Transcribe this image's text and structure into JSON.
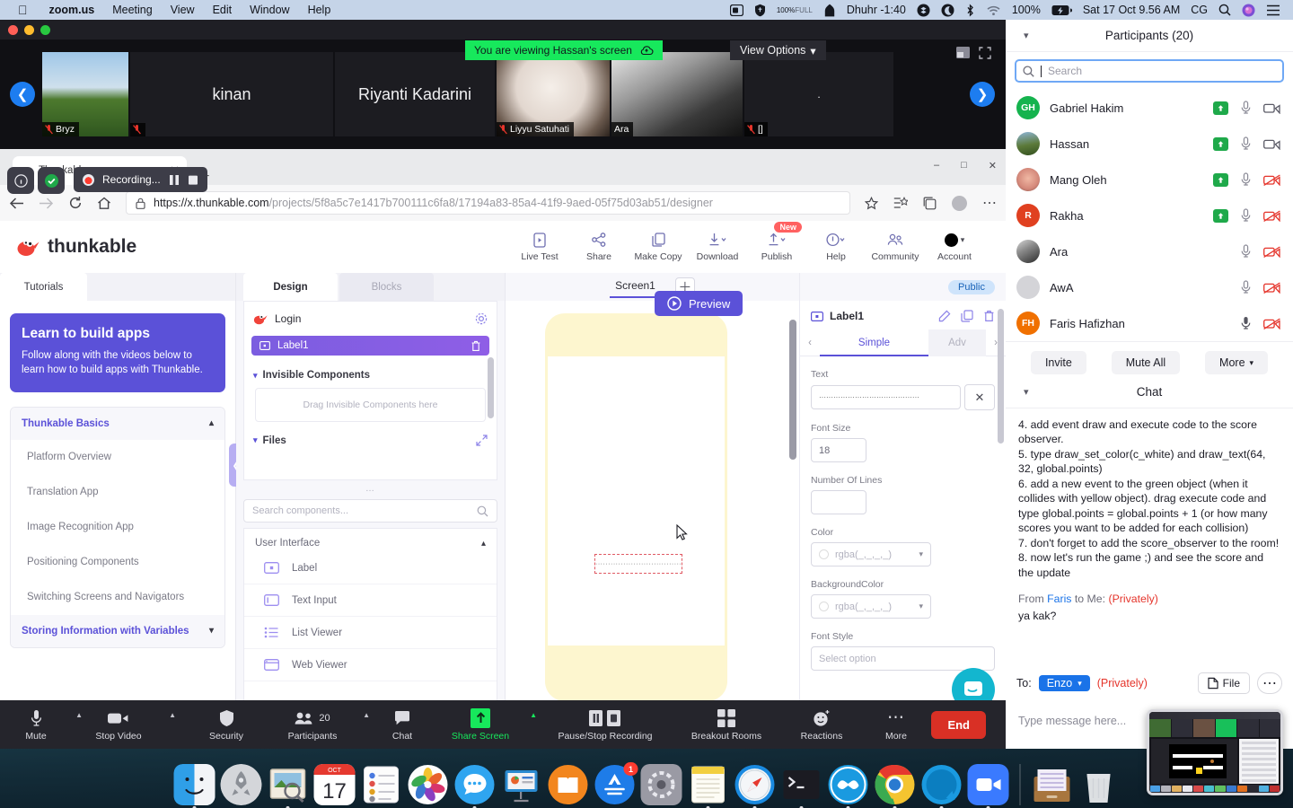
{
  "menubar": {
    "apple_icon": "apple-icon",
    "items": [
      "zoom.us",
      "Meeting",
      "View",
      "Edit",
      "Window",
      "Help"
    ],
    "right": {
      "screen_record_icon": "screen-record-icon",
      "shield_icon": "shield-icon",
      "volume_pct": "100%",
      "volume_sub": "FULL",
      "prayer_icon": "mosque-icon",
      "prayer_label": "Dhuhr -1:40",
      "dropbox_icon": "dropbox-icon",
      "moon_icon": "moon-icon",
      "bluetooth_icon": "bluetooth-icon",
      "wifi_icon": "wifi-icon",
      "battery_pct": "100%",
      "battery_icon": "battery-charging-icon",
      "datetime": "Sat 17 Oct  9.56 AM",
      "user": "CG",
      "search_icon": "search-icon",
      "siri_icon": "siri-icon",
      "controlcenter_icon": "control-center-icon"
    }
  },
  "zoom": {
    "share_banner": "You are viewing Hassan's screen",
    "share_banner_icon": "share-cloud-icon",
    "view_options": "View Options",
    "filmstrip": {
      "prev_icon": "chevron-left-icon",
      "next_icon": "chevron-right-icon",
      "view_icon": "gallery-view-icon",
      "fullscreen_icon": "fullscreen-icon",
      "tiles": [
        {
          "name": "Bryz",
          "display": "",
          "muted": true,
          "kind": "photo-sky"
        },
        {
          "name": "",
          "display": "kinan",
          "muted": true,
          "kind": "name"
        },
        {
          "name": "",
          "display": "Riyanti Kadarini",
          "muted": false,
          "kind": "name"
        },
        {
          "name": "Liyyu Satuhati",
          "display": "",
          "muted": true,
          "kind": "photo-cat"
        },
        {
          "name": "Ara",
          "display": "",
          "muted": false,
          "kind": "photo-bw"
        },
        {
          "name": "[]",
          "display": ".",
          "muted": true,
          "kind": "name"
        }
      ]
    },
    "toolbar": [
      {
        "label": "Mute",
        "icon": "microphone-icon",
        "caret": true
      },
      {
        "label": "Stop Video",
        "icon": "video-camera-icon",
        "caret": true
      },
      {
        "label": "Security",
        "icon": "shield-icon",
        "caret": false
      },
      {
        "label": "Participants",
        "icon": "participants-icon",
        "count": "20",
        "caret": true
      },
      {
        "label": "Chat",
        "icon": "chat-bubble-icon",
        "caret": false
      },
      {
        "label": "Share Screen",
        "icon": "share-screen-icon",
        "caret": true,
        "active": true
      },
      {
        "label": "Pause/Stop Recording",
        "icon": "pause-stop-recording-icon",
        "caret": false
      },
      {
        "label": "Breakout Rooms",
        "icon": "breakout-rooms-icon",
        "caret": false
      },
      {
        "label": "Reactions",
        "icon": "reactions-icon",
        "caret": false
      },
      {
        "label": "More",
        "icon": "more-dots-icon",
        "caret": false
      }
    ],
    "end_label": "End"
  },
  "recording_overlay": {
    "label": "Recording...",
    "record_icon": "record-dot-icon",
    "pause_icon": "pause-icon",
    "stop_icon": "stop-icon",
    "info_icon": "info-icon",
    "shield_icon": "shield-check-icon"
  },
  "browser": {
    "tab_title": "Thunkable",
    "tab_favicon": "thunkable-favicon",
    "close_icon": "close-icon",
    "newtab_icon": "plus-icon",
    "back_icon": "back-arrow-icon",
    "forward_icon": "forward-arrow-icon",
    "reload_icon": "reload-icon",
    "home_icon": "home-icon",
    "lock_icon": "lock-icon",
    "url_prefix": "https://",
    "url_host": "x.thunkable.com",
    "url_path": "/projects/5f8a5c7e1417b700111c6fa8/17194a83-85a4-41f9-9aed-05f75d03ab51/designer",
    "favorite_icon": "star-icon",
    "collections_icon": "collections-icon",
    "tabs_icon": "tab-copy-icon",
    "profile_icon": "profile-icon",
    "settings_icon": "more-dots-icon",
    "win_min": "minimize-icon",
    "win_max": "maximize-icon",
    "win_close": "close-icon"
  },
  "thunkable": {
    "brand": "thunkable",
    "header_actions": [
      {
        "label": "Live Test",
        "icon": "live-test-icon"
      },
      {
        "label": "Share",
        "icon": "share-node-icon"
      },
      {
        "label": "Make Copy",
        "icon": "copy-icon"
      },
      {
        "label": "Download",
        "icon": "download-icon"
      },
      {
        "label": "Publish",
        "icon": "publish-icon",
        "badge": "New"
      },
      {
        "label": "Help",
        "icon": "help-icon"
      },
      {
        "label": "Community",
        "icon": "community-icon"
      },
      {
        "label": "Account",
        "icon": "account-icon"
      }
    ],
    "tutorials": {
      "tab": "Tutorials",
      "banner_title": "Learn to build apps",
      "banner_text": "Follow along with the videos below to learn how to build apps with Thunkable.",
      "section_open": "Thunkable Basics",
      "items": [
        "Platform Overview",
        "Translation App",
        "Image Recognition App",
        "Positioning Components",
        "Switching Screens and Navigators"
      ],
      "section_closed": "Storing Information with Variables",
      "collapse_icon": "chevron-left-icon"
    },
    "designer": {
      "tab_design": "Design",
      "tab_blocks": "Blocks",
      "tree_root": "Login",
      "tree_root_icon": "thunkable-bird-icon",
      "gear_icon": "gear-icon",
      "selected_component": "Label1",
      "selected_icon": "label-icon",
      "delete_icon": "trash-icon",
      "invisible_section": "Invisible Components",
      "dropzone_text": "Drag Invisible Components here",
      "files_section": "Files",
      "expand_icon": "expand-icon",
      "search_placeholder": "Search components...",
      "search_icon": "search-icon",
      "palette_section": "User Interface",
      "palette_items": [
        {
          "label": "Label",
          "icon": "label-icon"
        },
        {
          "label": "Text Input",
          "icon": "text-input-icon"
        },
        {
          "label": "List Viewer",
          "icon": "list-viewer-icon"
        },
        {
          "label": "Web Viewer",
          "icon": "web-viewer-icon"
        }
      ]
    },
    "canvas": {
      "screen_tab": "Screen1",
      "add_screen_icon": "plus-icon",
      "preview_label": "Preview",
      "preview_icon": "play-circle-icon",
      "cursor_icon": "mouse-cursor-icon"
    },
    "properties": {
      "public_badge": "Public",
      "title": "Label1",
      "title_icon": "label-icon",
      "edit_icon": "pencil-icon",
      "duplicate_icon": "duplicate-icon",
      "delete_icon": "trash-icon",
      "tab_simple": "Simple",
      "tab_advanced": "Adv",
      "prev_icon": "chevron-left-icon",
      "next_icon": "chevron-right-icon",
      "fields": [
        {
          "label": "Text",
          "value": "··········································",
          "clear_icon": "close-icon"
        },
        {
          "label": "Font Size",
          "value": "18"
        },
        {
          "label": "Number Of Lines",
          "value": ""
        },
        {
          "label": "Color",
          "value": "rgba(_,_,_,_)"
        },
        {
          "label": "BackgroundColor",
          "value": "rgba(_,_,_,_)"
        },
        {
          "label": "Font Style",
          "value": "Select option"
        }
      ],
      "intercom_icon": "intercom-chat-icon"
    }
  },
  "participants": {
    "title": "Participants (20)",
    "collapse_icon": "chevron-down-icon",
    "search_placeholder": "Search",
    "search_icon": "search-icon",
    "list": [
      {
        "name": "Gabriel Hakim",
        "initials": "GH",
        "color": "#15b34e",
        "raise_hand": true,
        "mic": "mic-on-icon",
        "video": "video-on-icon"
      },
      {
        "name": "Hassan",
        "initials": "",
        "color": "#5c7a3a",
        "raise_hand": true,
        "mic": "mic-on-icon",
        "video": "video-on-icon"
      },
      {
        "name": "Mang Oleh",
        "initials": "",
        "color": "#d4887a",
        "raise_hand": true,
        "mic": "mic-on-icon",
        "video": "video-off-icon"
      },
      {
        "name": "Rakha",
        "initials": "R",
        "color": "#e04020",
        "raise_hand": true,
        "mic": "mic-on-icon",
        "video": "video-off-icon"
      },
      {
        "name": "Ara",
        "initials": "",
        "color": "#4a4a4a",
        "raise_hand": false,
        "mic": "mic-on-icon",
        "video": "video-off-icon"
      },
      {
        "name": "AwA",
        "initials": "",
        "color": "#d4d4d8",
        "raise_hand": false,
        "mic": "mic-on-icon",
        "video": "video-off-icon"
      },
      {
        "name": "Faris Hafizhan",
        "initials": "FH",
        "color": "#f07000",
        "raise_hand": false,
        "mic": "mic-on-icon",
        "video": "video-off-icon"
      }
    ],
    "buttons": {
      "invite": "Invite",
      "mute_all": "Mute All",
      "more": "More"
    }
  },
  "chat": {
    "title": "Chat",
    "collapse_icon": "chevron-down-icon",
    "messages": [
      "4. add event draw and execute code to the score observer.",
      "5. type draw_set_color(c_white) and draw_text(64, 32, global.points)",
      "6. add a new event to the green object (when it collides with yellow object). drag execute code and type global.points = global.points + 1 (or how many scores you want to be added for each collision)",
      "7. don't forget to add the score_observer to the room!",
      "8. now let's run the game ;) and see the score and the update"
    ],
    "from_prefix": "From",
    "from_who": "Faris",
    "from_mid": "to Me:",
    "from_priv": "(Privately)",
    "from_body": "ya kak?",
    "to_label": "To:",
    "to_target": "Enzo",
    "to_priv": "(Privately)",
    "file_label": "File",
    "file_icon": "file-icon",
    "more_icon": "more-dots-icon",
    "input_placeholder": "Type message here..."
  },
  "dock": {
    "items": [
      {
        "name": "finder",
        "running": true
      },
      {
        "name": "launchpad",
        "running": false
      },
      {
        "name": "preview",
        "running": true
      },
      {
        "name": "calendar",
        "running": false,
        "day": "17",
        "month": "OCT"
      },
      {
        "name": "reminders",
        "running": false
      },
      {
        "name": "photos",
        "running": false
      },
      {
        "name": "messages",
        "running": true
      },
      {
        "name": "keynote",
        "running": false
      },
      {
        "name": "ibooks",
        "running": false
      },
      {
        "name": "app-store",
        "running": false,
        "badge": "1"
      },
      {
        "name": "system-preferences",
        "running": false
      },
      {
        "name": "notes",
        "running": true
      },
      {
        "name": "safari",
        "running": true
      },
      {
        "name": "terminal",
        "running": true
      },
      {
        "name": "gamemaker",
        "running": true
      },
      {
        "name": "chrome",
        "running": true
      },
      {
        "name": "skype",
        "running": true
      },
      {
        "name": "zoom",
        "running": true
      },
      {
        "name": "downloads-stack",
        "running": false
      },
      {
        "name": "trash",
        "running": false
      }
    ]
  }
}
